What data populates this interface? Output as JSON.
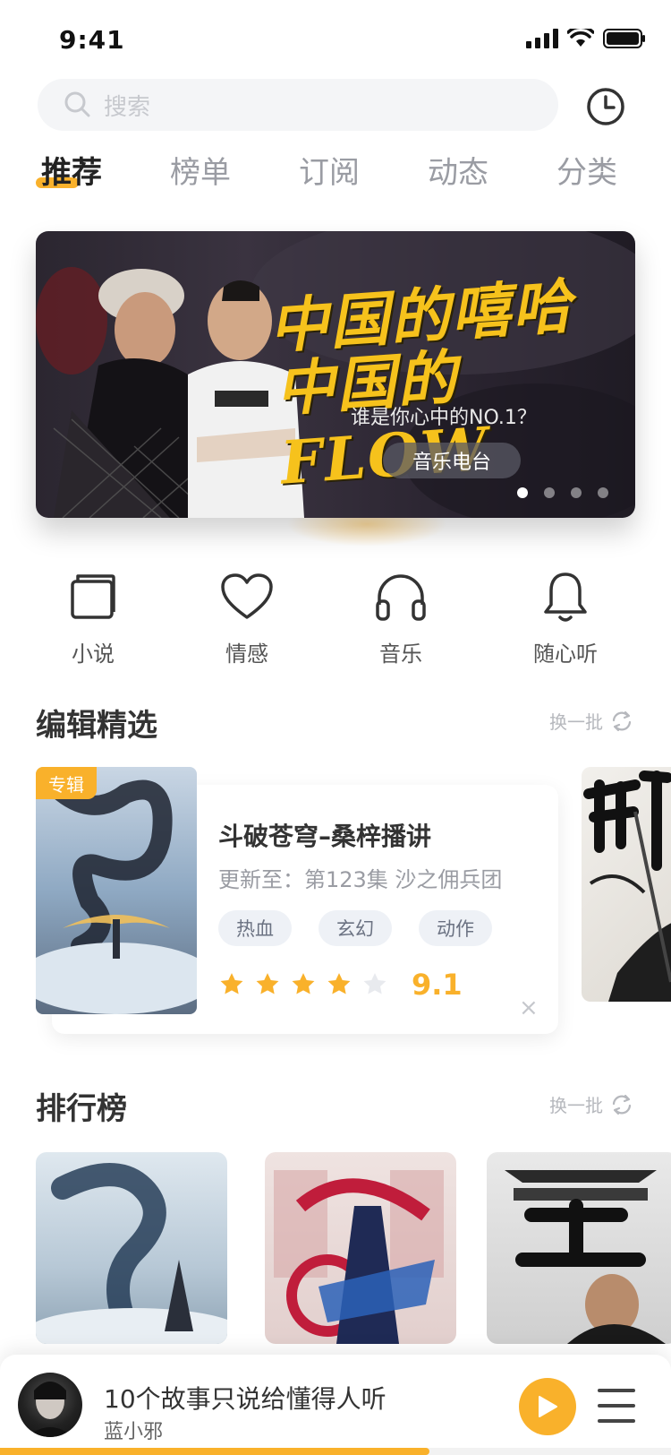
{
  "status_bar": {
    "time": "9:41"
  },
  "search": {
    "placeholder": "搜索"
  },
  "tabs": [
    {
      "label": "推荐",
      "active": true
    },
    {
      "label": "榜单",
      "active": false
    },
    {
      "label": "订阅",
      "active": false
    },
    {
      "label": "动态",
      "active": false
    },
    {
      "label": "分类",
      "active": false
    }
  ],
  "banner": {
    "title_line1": "中国的嘻哈",
    "title_line2": "中国的FLOW",
    "subtitle": "谁是你心中的NO.1？",
    "button_label": "音乐电台",
    "slide_count": 4,
    "active_slide": 1
  },
  "categories": [
    {
      "label": "小说",
      "icon": "book-icon"
    },
    {
      "label": "情感",
      "icon": "heart-icon"
    },
    {
      "label": "音乐",
      "icon": "headphones-icon"
    },
    {
      "label": "随心听",
      "icon": "bell-icon"
    }
  ],
  "editor_picks": {
    "title": "编辑精选",
    "refresh_label": "换一批",
    "card": {
      "tag": "专辑",
      "title": "斗破苍穹–桑梓播讲",
      "update": "更新至：第123集 沙之佣兵团",
      "chips": [
        "热血",
        "玄幻",
        "动作"
      ],
      "stars": 4,
      "rating": "9.1",
      "close": "×"
    }
  },
  "ranking": {
    "title": "排行榜",
    "refresh_label": "换一批"
  },
  "player": {
    "title": "10个故事只说给懂得人听",
    "artist": "蓝小邪",
    "progress": 0.64
  },
  "colors": {
    "accent": "#f9b12b",
    "text_primary": "#333333",
    "text_muted": "#9a9ca3",
    "chip_bg": "#eef1f6"
  }
}
